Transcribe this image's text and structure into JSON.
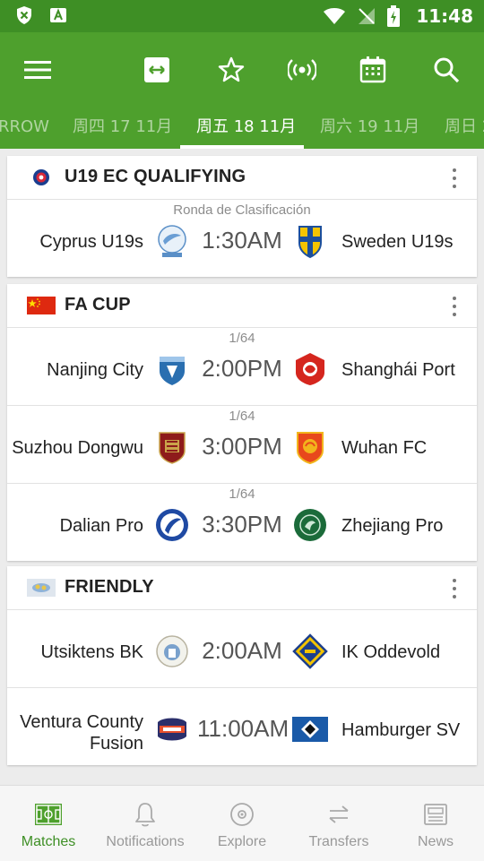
{
  "status_bar": {
    "time": "11:48"
  },
  "app_bar": {
    "icons": [
      "menu-icon",
      "today-icon",
      "star-icon",
      "live-icon",
      "calendar-icon",
      "search-icon"
    ]
  },
  "date_tabs": [
    {
      "label": "RROW"
    },
    {
      "label": "周四 17 11月"
    },
    {
      "label": "周五 18 11月",
      "active": true
    },
    {
      "label": "周六 19 11月"
    },
    {
      "label": "周日 2"
    }
  ],
  "competitions": [
    {
      "name": "U19 EC QUALIFYING",
      "flag": "uefa-flag",
      "matches": [
        {
          "round": "Ronda de Clasificación",
          "home": "Cyprus U19s",
          "time": "1:30AM",
          "away": "Sweden U19s"
        }
      ]
    },
    {
      "name": "FA CUP",
      "flag": "china-flag",
      "matches": [
        {
          "round": "1/64",
          "home": "Nanjing City",
          "time": "2:00PM",
          "away": "Shanghái Port"
        },
        {
          "round": "1/64",
          "home": "Suzhou Dongwu",
          "time": "3:00PM",
          "away": "Wuhan FC"
        },
        {
          "round": "1/64",
          "home": "Dalian Pro",
          "time": "3:30PM",
          "away": "Zhejiang Pro"
        }
      ]
    },
    {
      "name": "FRIENDLY",
      "flag": "world-flag",
      "matches": [
        {
          "round": "",
          "home": "Utsiktens BK",
          "time": "2:00AM",
          "away": "IK Oddevold"
        },
        {
          "round": "",
          "home_line1": "Ventura County",
          "home_line2": "Fusion",
          "time": "11:00AM",
          "away": "Hamburger SV"
        }
      ]
    }
  ],
  "bottom_nav": [
    {
      "label": "Matches",
      "icon": "pitch-icon",
      "active": true
    },
    {
      "label": "Notifications",
      "icon": "bell-icon"
    },
    {
      "label": "Explore",
      "icon": "compass-icon"
    },
    {
      "label": "Transfers",
      "icon": "transfer-icon"
    },
    {
      "label": "News",
      "icon": "news-icon"
    }
  ],
  "colors": {
    "primary": "#4ea02d",
    "primary_dark": "#3e8f25"
  }
}
